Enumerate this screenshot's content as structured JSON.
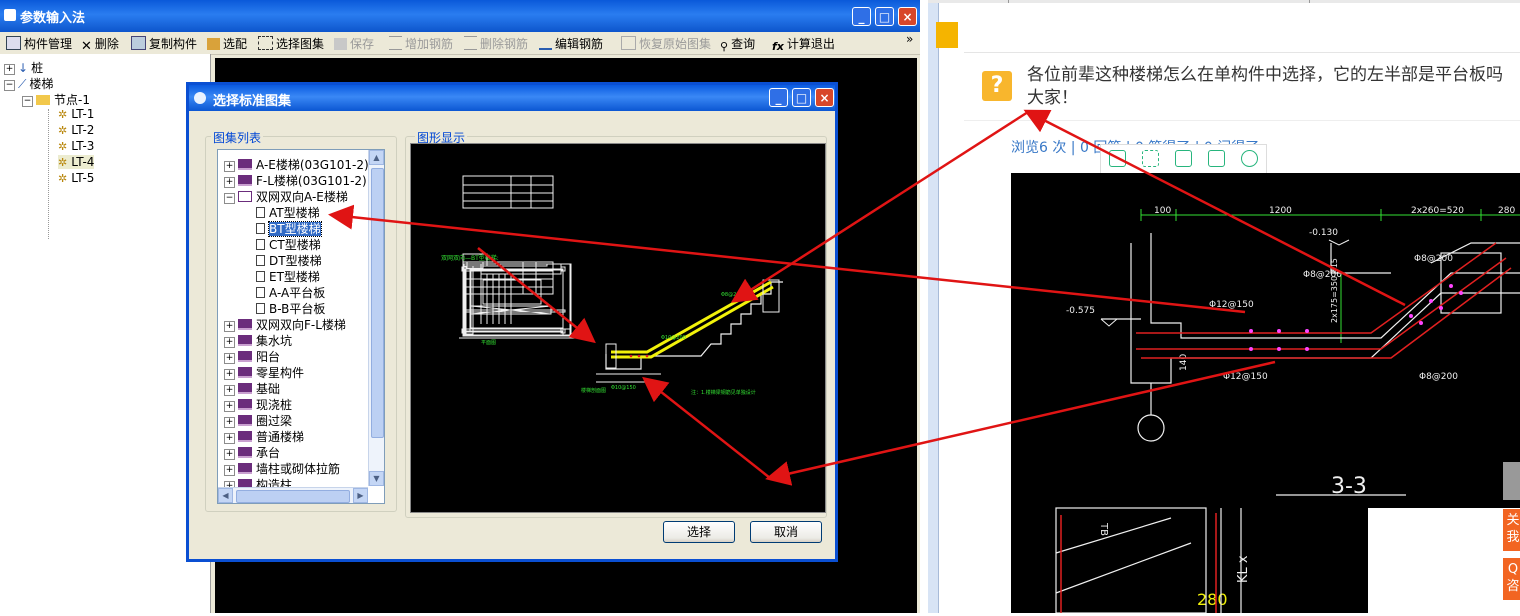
{
  "app": {
    "title": "参数输入法",
    "window_buttons": [
      "_",
      "□",
      "×"
    ],
    "toolbar": [
      {
        "label": "构件管理",
        "icon": "component-icon",
        "enabled": true
      },
      {
        "label": "删除",
        "icon": "delete-x-icon",
        "enabled": true
      },
      {
        "label": "复制构件",
        "icon": "copy-icon",
        "enabled": true
      },
      {
        "label": "选配",
        "icon": "select-icon",
        "enabled": true
      },
      {
        "label": "选择图集",
        "icon": "atlas-icon",
        "enabled": true
      },
      {
        "label": "保存",
        "icon": "save-icon",
        "enabled": false
      },
      {
        "label": "增加钢筋",
        "icon": "add-rebar-icon",
        "enabled": false
      },
      {
        "label": "删除钢筋",
        "icon": "remove-rebar-icon",
        "enabled": false
      },
      {
        "label": "编辑钢筋",
        "icon": "edit-rebar-icon",
        "enabled": true
      },
      {
        "label": "恢复原始图集",
        "icon": "restore-icon",
        "enabled": false
      },
      {
        "label": "查询",
        "icon": "binoculars-icon",
        "enabled": true
      },
      {
        "label": "计算退出",
        "icon": "fx-icon",
        "enabled": true
      }
    ],
    "overflow": "»",
    "tree": {
      "root1": "桩",
      "root2": "楼梯",
      "node": "节点-1",
      "items": [
        "LT-1",
        "LT-2",
        "LT-3",
        "LT-4",
        "LT-5"
      ],
      "selected": "LT-4"
    }
  },
  "dialog": {
    "title": "选择标准图集",
    "list_group_label": "图集列表",
    "preview_group_label": "图形显示",
    "atlas": [
      {
        "label": "A-E楼梯(03G101-2)",
        "level": 0,
        "expander": "+",
        "icon": "book"
      },
      {
        "label": "F-L楼梯(03G101-2)",
        "level": 0,
        "expander": "+",
        "icon": "book"
      },
      {
        "label": "双网双向A-E楼梯",
        "level": 0,
        "expander": "-",
        "icon": "open-book"
      },
      {
        "label": "AT型楼梯",
        "level": 1,
        "icon": "doc"
      },
      {
        "label": "BT型楼梯",
        "level": 1,
        "icon": "doc",
        "selected": true
      },
      {
        "label": "CT型楼梯",
        "level": 1,
        "icon": "doc"
      },
      {
        "label": "DT型楼梯",
        "level": 1,
        "icon": "doc"
      },
      {
        "label": "ET型楼梯",
        "level": 1,
        "icon": "doc"
      },
      {
        "label": "A-A平台板",
        "level": 1,
        "icon": "doc"
      },
      {
        "label": "B-B平台板",
        "level": 1,
        "icon": "doc"
      },
      {
        "label": "双网双向F-L楼梯",
        "level": 0,
        "expander": "+",
        "icon": "book"
      },
      {
        "label": "集水坑",
        "level": 0,
        "expander": "+",
        "icon": "book"
      },
      {
        "label": "阳台",
        "level": 0,
        "expander": "+",
        "icon": "book"
      },
      {
        "label": "零星构件",
        "level": 0,
        "expander": "+",
        "icon": "book"
      },
      {
        "label": "基础",
        "level": 0,
        "expander": "+",
        "icon": "book"
      },
      {
        "label": "现浇桩",
        "level": 0,
        "expander": "+",
        "icon": "book"
      },
      {
        "label": "圈过梁",
        "level": 0,
        "expander": "+",
        "icon": "book"
      },
      {
        "label": "普通楼梯",
        "level": 0,
        "expander": "+",
        "icon": "book"
      },
      {
        "label": "承台",
        "level": 0,
        "expander": "+",
        "icon": "book"
      },
      {
        "label": "墙柱或砌体拉筋",
        "level": 0,
        "expander": "+",
        "icon": "book"
      },
      {
        "label": "构造柱",
        "level": 0,
        "expander": "+",
        "icon": "book"
      }
    ],
    "select_button": "选择",
    "cancel_button": "取消"
  },
  "question": {
    "text_line1": "各位前辈这种楼梯怎么在单构件中选择，它的左半部是平台板吗",
    "text_line2": "大家！",
    "stats": "浏览6 次 | 0 回答 | 0 答得了 | 0 问得了"
  },
  "cad": {
    "dims_top": [
      "100",
      "1200",
      "2x260=520",
      "280"
    ],
    "level_mark": "-0.130",
    "level_mark2": "-0.575",
    "bars": [
      "Φ8@200",
      "Φ8@200",
      "Φ12@150",
      "Φ12@150",
      "Φ8@200"
    ],
    "vert_dim": "2x175=350 415",
    "dim_140": "140",
    "section_label": "3-3",
    "beam_label": "KL x",
    "dim_bottom": "280",
    "slab_label": "TB"
  },
  "side_tabs": [
    "关",
    "我",
    "Q",
    "咨"
  ],
  "colors": {
    "arrow": "#e01414",
    "title_blue": "#0a5ae0",
    "cad_white": "#f0f0f0",
    "cad_green": "#33e033",
    "cad_yellow": "#f2f20a",
    "cad_red": "#e02020",
    "cad_magenta": "#ff44ff"
  }
}
